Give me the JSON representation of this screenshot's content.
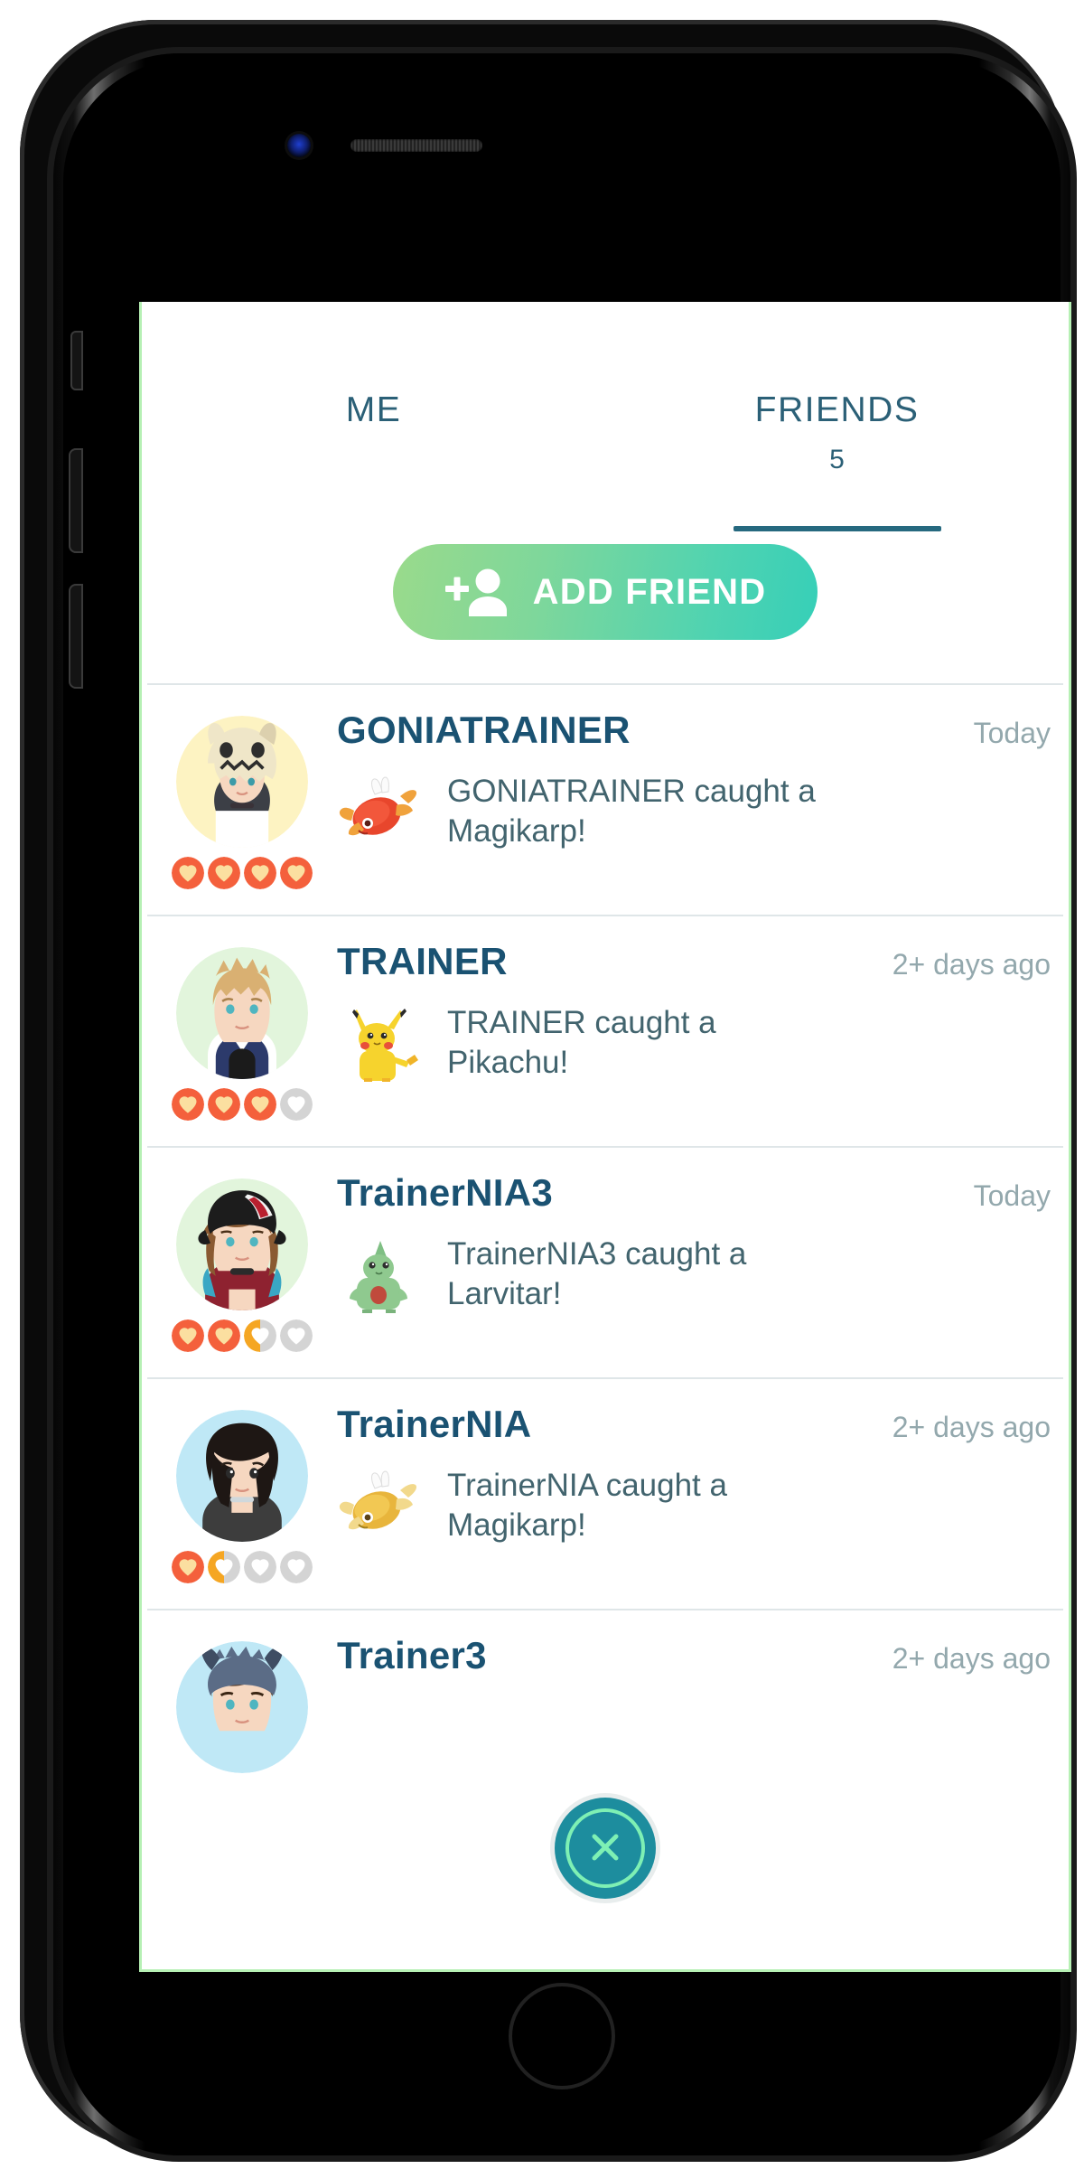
{
  "device": {
    "camera_icon": "camera-icon",
    "speaker_icon": "speaker-grille-icon",
    "home_button": "home-button"
  },
  "tabs": [
    {
      "id": "me",
      "label": "ME",
      "count": "",
      "active": false
    },
    {
      "id": "friends",
      "label": "FRIENDS",
      "count": "5",
      "active": true
    }
  ],
  "toolbar": {
    "add_friend_label": "ADD FRIEND",
    "add_friend_icon": "person-add-icon"
  },
  "colors": {
    "accent_teal": "#1a5272",
    "tab_text": "#2b6077",
    "tab_underline": "#26697f",
    "button_gradient_start": "#9ada8b",
    "button_gradient_end": "#36cfb8",
    "activity_text": "#42646e",
    "timestamp_text": "#93a8ad",
    "heart_full": "#f4603c",
    "heart_half": "#f5a623",
    "heart_empty": "#d4d4d4",
    "heart_inner": "#fbdfa0",
    "divider": "#dfe6e8",
    "fab_background": "#1d8d9e",
    "fab_ring": "#7ef0b4",
    "screen_border": "#b6f0b4"
  },
  "friends": [
    {
      "name": "GONIATRAINER",
      "timestamp": "Today",
      "activity": "GONIATRAINER caught a Magikarp!",
      "pokemon": "magikarp",
      "hearts": [
        "full",
        "full",
        "full",
        "full"
      ],
      "avatar": {
        "bg": "#fdf3c2",
        "hair": "#e8d79a",
        "skin": "#f6d7c0",
        "hat": "#efe6c8",
        "accent": "#2e2e2e"
      }
    },
    {
      "name": "TRAINER",
      "timestamp": "2+ days ago",
      "activity": "TRAINER caught a Pikachu!",
      "pokemon": "pikachu",
      "hearts": [
        "full",
        "full",
        "full",
        "empty"
      ],
      "avatar": {
        "bg": "#e2f5dc",
        "hair": "#d9b072",
        "skin": "#f6d7c0",
        "hat": "",
        "accent": "#2c3a6b"
      }
    },
    {
      "name": "TrainerNIA3",
      "timestamp": "Today",
      "activity": "TrainerNIA3 caught a Larvitar!",
      "pokemon": "larvitar",
      "hearts": [
        "full",
        "full",
        "half",
        "empty"
      ],
      "avatar": {
        "bg": "#e2f5dc",
        "hair": "#8a5a32",
        "skin": "#f6d7c0",
        "hat": "#1c1c1c",
        "accent": "#8e2230"
      }
    },
    {
      "name": "TrainerNIA",
      "timestamp": "2+ days ago",
      "activity": "TrainerNIA caught a Magikarp!",
      "pokemon": "magikarp-shiny",
      "hearts": [
        "full",
        "half",
        "empty",
        "empty"
      ],
      "avatar": {
        "bg": "#bfe8f6",
        "hair": "#1e1714",
        "skin": "#f6d7c0",
        "hat": "",
        "accent": "#3d3d3d"
      }
    },
    {
      "name": "Trainer3",
      "timestamp": "2+ days ago",
      "activity": "",
      "pokemon": "",
      "hearts": [],
      "avatar": {
        "bg": "#bfe8f6",
        "hair": "#5a3a22",
        "skin": "#f6d7c0",
        "hat": "#5b6c86",
        "accent": "#3d3d3d"
      }
    }
  ],
  "close_button": {
    "label": "close",
    "icon": "close-x-icon"
  }
}
